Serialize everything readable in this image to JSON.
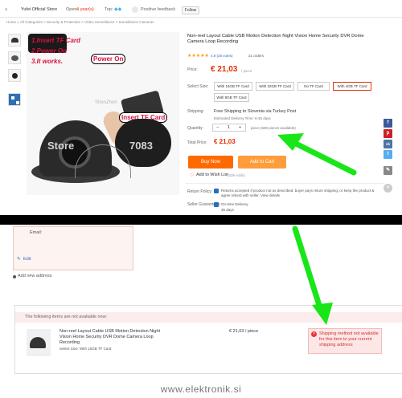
{
  "store_bar": {
    "store_name": "Yufei Official Store",
    "open_label": "Open:",
    "open_years": "4 year(s)",
    "rating_label": "Top:",
    "feedback": "Positive feedback",
    "follow_label": "Follow"
  },
  "breadcrumb": "Home > All Categories > Security & Protection > Video Surveillance > Surveillance Cameras",
  "gallery": {
    "annotation_1": "1.Insert TF Card",
    "annotation_2": "2.Power On",
    "annotation_3": "3.It works.",
    "label_power": "Power On",
    "label_insert": "Insert TF Card",
    "watermark_store": "Store",
    "watermark_num": "7083",
    "watermark_shop": "ShenZhen"
  },
  "product": {
    "title": "Non-reel Layout Cable USB Motion Detection Night Vision Home Security DVR Dome Camera Loop Recording",
    "rating_stars": "★★★★★",
    "rating_text": "4.8 (26 votes)",
    "orders": "21 orders",
    "price_label": "Price:",
    "price": "€ 21,03",
    "price_unit": "/ piece",
    "option_label": "Select Size:",
    "options": [
      "With 16GB TF Card",
      "With 32GB TF Card",
      "No TF Card",
      "With 4GB TF Card",
      "With 8GB TF Card"
    ],
    "shipping_label": "Shipping:",
    "shipping_text": "Free Shipping to Slovenia via Turkey Post",
    "delivery_text": "Estimated Delivery Time: 6-35 days",
    "quantity_label": "Quantity:",
    "quantity_value": "1",
    "quantity_minus": "−",
    "quantity_plus": "+",
    "pieces_available": "piece (689 pieces available)",
    "total_label": "Total Price:",
    "total_price": "€ 21,03",
    "buy_now": "Buy Now",
    "add_to_cart": "Add to Cart",
    "wish_list": "Add to Wish List",
    "wish_count": "(339 Adds)",
    "return_label": "Return Policy:",
    "return_text": "Returns accepted if product not as described, buyer pays return shipping; or keep the product & agree refund with seller. View details",
    "guarantee_label": "Seller Guarantees:",
    "guarantee_text": "On-time Delivery",
    "guarantee_days": "35 days"
  },
  "share_icons": [
    "f",
    "p",
    "vk",
    "t",
    "✎",
    "×"
  ],
  "address": {
    "box_text": "Email:",
    "edit_link": "Edit",
    "add_new": "Add new address"
  },
  "order_summary": {
    "header": "The following items are not available now:",
    "item_title": "Non-reel Layout Cable USB Motion Detection Night Vision Home Security DVR Dome Camera Loop Recording",
    "item_option": "Select Size: With 16GB TF Card",
    "item_price": "€ 21,03 / piece",
    "error_text": "Shipping method not available for this item to your current shipping address"
  },
  "watermark": "www.elektronik.si",
  "colors": {
    "price": "#e62e04",
    "buy_now": "#ff6a00",
    "add_to_cart": "#ff9c3c",
    "arrow": "#19e619",
    "annotation": "#d9123b"
  }
}
